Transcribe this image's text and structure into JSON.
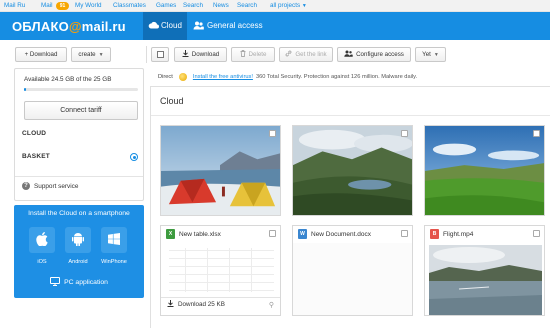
{
  "portal_nav": {
    "items": [
      "Mail Ru",
      "Mail",
      "My World",
      "Classmates",
      "Games",
      "Search",
      "News",
      "Search",
      "all projects"
    ],
    "mail_badge": "91"
  },
  "header": {
    "logo_prefix": "ОБЛАКО",
    "logo_at": "@",
    "logo_suffix": "mail.ru",
    "tabs": [
      {
        "label": "Cloud",
        "icon": "cloud-icon",
        "active": true
      },
      {
        "label": "General access",
        "icon": "people-icon",
        "active": false
      }
    ],
    "accent": "#168de2",
    "active_tab_color": "#0f6fb8"
  },
  "toolbar": {
    "download_left_label": "+ Download",
    "create_label": "create",
    "download_label": "Download",
    "delete_label": "Delete",
    "get_link_label": "Get the link",
    "configure_access_label": "Configure access",
    "yet_label": "Yet"
  },
  "sidebar": {
    "storage_text": "Available 24.5 GB of the 25 GB",
    "storage_used_fraction": 0.02,
    "connect_tariff_label": "Connect tariff",
    "items": [
      {
        "label": "CLOUD"
      },
      {
        "label": "BASKET"
      }
    ],
    "support_label": "Support service"
  },
  "promo": {
    "title": "Install the Cloud on a smartphone",
    "stores": [
      {
        "label": "iOS",
        "icon": "apple-icon"
      },
      {
        "label": "Android",
        "icon": "android-icon"
      },
      {
        "label": "WinPhone",
        "icon": "windows-icon"
      }
    ],
    "pc_label": "PC application",
    "background": "#1e8fe4"
  },
  "ad": {
    "direct_label": "Direct",
    "link_text": "Install the free antivirus!",
    "rest_text": "360 Total Security. Protection against 126 million. Malware daily."
  },
  "content": {
    "folder_title": "Cloud",
    "files": [
      {
        "type": "photo",
        "icon": "photo-tents"
      },
      {
        "type": "photo",
        "icon": "photo-lake-valley"
      },
      {
        "type": "photo",
        "icon": "photo-green-meadow"
      },
      {
        "type": "file",
        "name": "New table.xlsx",
        "icon": "excel-icon",
        "icon_letter": "X",
        "icon_color": "#3d9b3f",
        "footer": "Download 25 KB"
      },
      {
        "type": "file",
        "name": "New Document.docx",
        "icon": "word-icon",
        "icon_letter": "W",
        "icon_color": "#3a86d0"
      },
      {
        "type": "file",
        "name": "Flight.mp4",
        "icon": "video-icon",
        "icon_letter": "B",
        "icon_color": "#e5534b"
      }
    ]
  }
}
